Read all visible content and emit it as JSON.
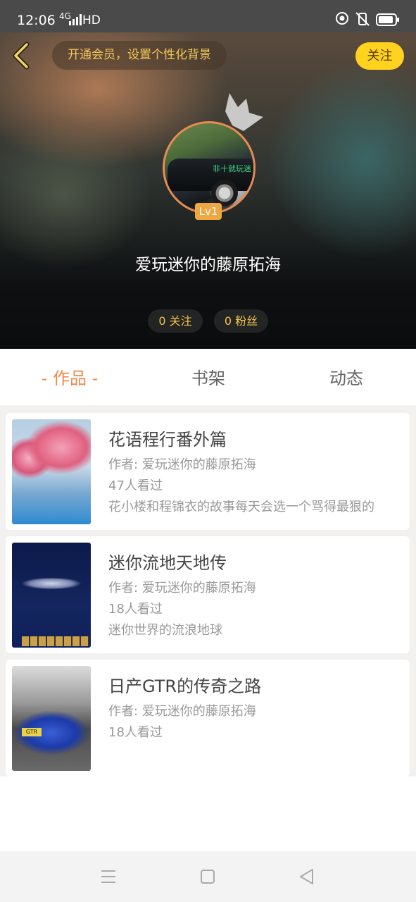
{
  "status_bar": {
    "time": "12:06",
    "network": "4G",
    "network_type": "HD",
    "icons": [
      "signal-icon",
      "nfc-icon",
      "mute-icon",
      "battery-icon"
    ]
  },
  "header": {
    "vip_banner": "开通会员，设置个性化背景",
    "follow_button": "关注",
    "level": "Lv1",
    "username": "爱玩迷你的藤原拓海",
    "following": "0 关注",
    "followers": "0 粉丝"
  },
  "tabs": [
    {
      "label": "- 作品 -",
      "active": true
    },
    {
      "label": "书架",
      "active": false
    },
    {
      "label": "动态",
      "active": false
    }
  ],
  "works": [
    {
      "title": "花语程行番外篇",
      "author": "作者: 爱玩迷你的藤原拓海",
      "views": "47人看过",
      "desc": "花小楼和程锦衣的故事每天会选一个骂得最狠的"
    },
    {
      "title": "迷你流地天地传",
      "author": "作者: 爱玩迷你的藤原拓海",
      "views": "18人看过",
      "desc": "迷你世界的流浪地球"
    },
    {
      "title": "日产GTR的传奇之路",
      "author": "作者: 爱玩迷你的藤原拓海",
      "views": "18人看过",
      "desc": ""
    }
  ],
  "thumb_text": {
    "avatar_tag": "非十就玩迷",
    "plate": "GTR"
  },
  "colors": {
    "accent": "#f08a4b",
    "vip_text": "#f3c85a",
    "follow_bg": "#ffd21f",
    "level_bg": "#f0a742"
  }
}
